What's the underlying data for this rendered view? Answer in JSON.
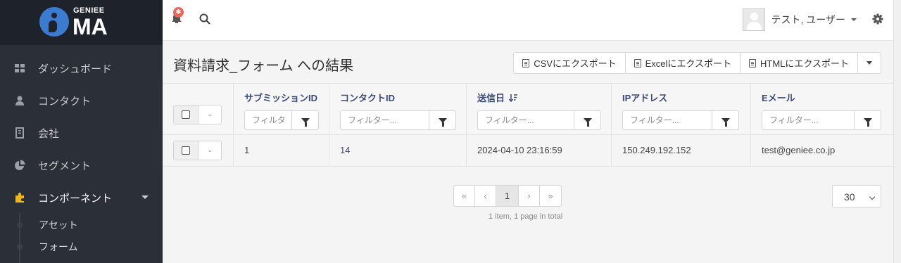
{
  "brand": {
    "small": "GENIEE",
    "big": "MA"
  },
  "sidebar": {
    "items": [
      {
        "label": "ダッシュボード",
        "icon": "dashboard-icon"
      },
      {
        "label": "コンタクト",
        "icon": "user-icon"
      },
      {
        "label": "会社",
        "icon": "building-icon"
      },
      {
        "label": "セグメント",
        "icon": "pie-chart-icon"
      },
      {
        "label": "コンポーネント",
        "icon": "puzzle-icon",
        "active": true
      }
    ],
    "subitems": [
      {
        "label": "アセット"
      },
      {
        "label": "フォーム"
      }
    ]
  },
  "header": {
    "notification_badge": "✱",
    "user_name": "テスト, ユーザー"
  },
  "page": {
    "title": "資料請求_フォーム への結果",
    "exports": {
      "csv": "CSVにエクスポート",
      "excel": "Excelにエクスポート",
      "html": "HTMLにエクスポート"
    }
  },
  "table": {
    "columns": [
      {
        "label": "サブミッションID",
        "placeholder": "フィルタ"
      },
      {
        "label": "コンタクトID",
        "placeholder": "フィルター..."
      },
      {
        "label": "送信日",
        "placeholder": "フィルター..."
      },
      {
        "label": "IPアドレス",
        "placeholder": "フィルター..."
      },
      {
        "label": "Eメール",
        "placeholder": "フィルター..."
      }
    ],
    "rows": [
      {
        "submission_id": "1",
        "contact_id": "14",
        "date": "2024-04-10 23:16:59",
        "ip": "150.249.192.152",
        "email": "test@geniee.co.jp"
      }
    ]
  },
  "pagination": {
    "first": "«",
    "prev": "‹",
    "current": "1",
    "next": "›",
    "last": "»",
    "info": "1 item, 1 page in total",
    "per_page": "30"
  },
  "colors": {
    "sidebar_bg": "#2a2f38",
    "accent": "#3b7bd0",
    "active_icon": "#f0b51e",
    "header_link": "#3a4a7a"
  }
}
